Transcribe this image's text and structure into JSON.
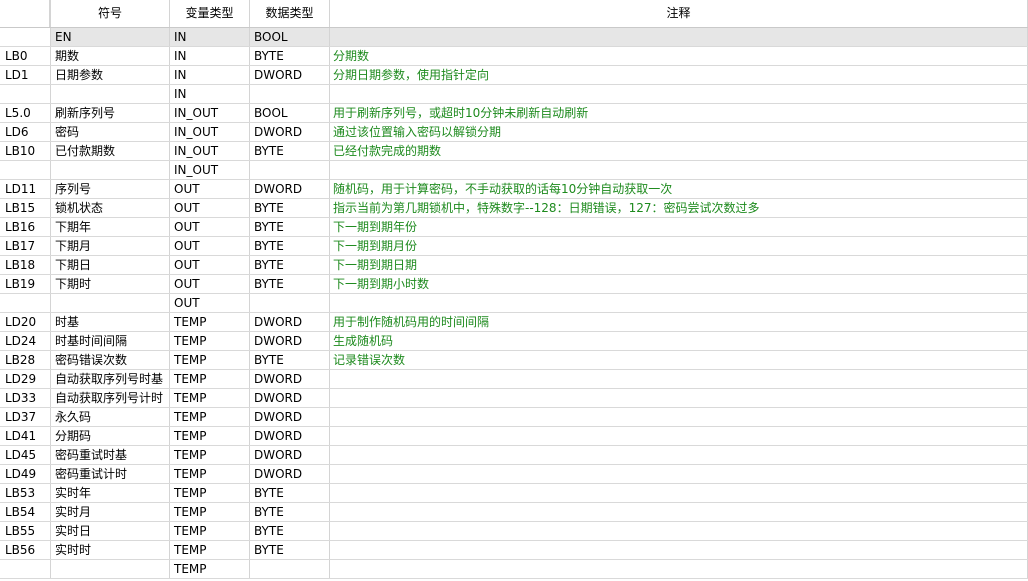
{
  "headers": {
    "addr": "",
    "symbol": "符号",
    "var_type": "变量类型",
    "data_type": "数据类型",
    "comment": "注释"
  },
  "rows": [
    {
      "addr": "",
      "symbol": "EN",
      "var_type": "IN",
      "data_type": "BOOL",
      "comment": ""
    },
    {
      "addr": "LB0",
      "symbol": "期数",
      "var_type": "IN",
      "data_type": "BYTE",
      "comment": "分期数"
    },
    {
      "addr": "LD1",
      "symbol": "日期参数",
      "var_type": "IN",
      "data_type": "DWORD",
      "comment": "分期日期参数，使用指针定向"
    },
    {
      "addr": "",
      "symbol": "",
      "var_type": "IN",
      "data_type": "",
      "comment": ""
    },
    {
      "addr": "L5.0",
      "symbol": "刷新序列号",
      "var_type": "IN_OUT",
      "data_type": "BOOL",
      "comment": "用于刷新序列号，或超时10分钟未刷新自动刷新"
    },
    {
      "addr": "LD6",
      "symbol": "密码",
      "var_type": "IN_OUT",
      "data_type": "DWORD",
      "comment": "通过该位置输入密码以解锁分期"
    },
    {
      "addr": "LB10",
      "symbol": "已付款期数",
      "var_type": "IN_OUT",
      "data_type": "BYTE",
      "comment": "已经付款完成的期数"
    },
    {
      "addr": "",
      "symbol": "",
      "var_type": "IN_OUT",
      "data_type": "",
      "comment": ""
    },
    {
      "addr": "LD11",
      "symbol": "序列号",
      "var_type": "OUT",
      "data_type": "DWORD",
      "comment": "随机码，用于计算密码，不手动获取的话每10分钟自动获取一次"
    },
    {
      "addr": "LB15",
      "symbol": "锁机状态",
      "var_type": "OUT",
      "data_type": "BYTE",
      "comment": "指示当前为第几期锁机中，特殊数字--128：日期错误，127：密码尝试次数过多"
    },
    {
      "addr": "LB16",
      "symbol": "下期年",
      "var_type": "OUT",
      "data_type": "BYTE",
      "comment": "下一期到期年份"
    },
    {
      "addr": "LB17",
      "symbol": "下期月",
      "var_type": "OUT",
      "data_type": "BYTE",
      "comment": "下一期到期月份"
    },
    {
      "addr": "LB18",
      "symbol": "下期日",
      "var_type": "OUT",
      "data_type": "BYTE",
      "comment": "下一期到期日期"
    },
    {
      "addr": "LB19",
      "symbol": "下期时",
      "var_type": "OUT",
      "data_type": "BYTE",
      "comment": "下一期到期小时数"
    },
    {
      "addr": "",
      "symbol": "",
      "var_type": "OUT",
      "data_type": "",
      "comment": ""
    },
    {
      "addr": "LD20",
      "symbol": "时基",
      "var_type": "TEMP",
      "data_type": "DWORD",
      "comment": "用于制作随机码用的时间间隔"
    },
    {
      "addr": "LD24",
      "symbol": "时基时间间隔",
      "var_type": "TEMP",
      "data_type": "DWORD",
      "comment": "生成随机码"
    },
    {
      "addr": "LB28",
      "symbol": "密码错误次数",
      "var_type": "TEMP",
      "data_type": "BYTE",
      "comment": "记录错误次数"
    },
    {
      "addr": "LD29",
      "symbol": "自动获取序列号时基",
      "var_type": "TEMP",
      "data_type": "DWORD",
      "comment": ""
    },
    {
      "addr": "LD33",
      "symbol": "自动获取序列号计时",
      "var_type": "TEMP",
      "data_type": "DWORD",
      "comment": ""
    },
    {
      "addr": "LD37",
      "symbol": "永久码",
      "var_type": "TEMP",
      "data_type": "DWORD",
      "comment": ""
    },
    {
      "addr": "LD41",
      "symbol": "分期码",
      "var_type": "TEMP",
      "data_type": "DWORD",
      "comment": ""
    },
    {
      "addr": "LD45",
      "symbol": "密码重试时基",
      "var_type": "TEMP",
      "data_type": "DWORD",
      "comment": ""
    },
    {
      "addr": "LD49",
      "symbol": "密码重试计时",
      "var_type": "TEMP",
      "data_type": "DWORD",
      "comment": ""
    },
    {
      "addr": "LB53",
      "symbol": "实时年",
      "var_type": "TEMP",
      "data_type": "BYTE",
      "comment": ""
    },
    {
      "addr": "LB54",
      "symbol": "实时月",
      "var_type": "TEMP",
      "data_type": "BYTE",
      "comment": ""
    },
    {
      "addr": "LB55",
      "symbol": "实时日",
      "var_type": "TEMP",
      "data_type": "BYTE",
      "comment": ""
    },
    {
      "addr": "LB56",
      "symbol": "实时时",
      "var_type": "TEMP",
      "data_type": "BYTE",
      "comment": ""
    },
    {
      "addr": "",
      "symbol": "",
      "var_type": "TEMP",
      "data_type": "",
      "comment": ""
    }
  ],
  "colors": {
    "comment_text": "#1d8a1d",
    "en_row_bg": "#e6e6e6",
    "grid_line": "#d4d4d4"
  }
}
